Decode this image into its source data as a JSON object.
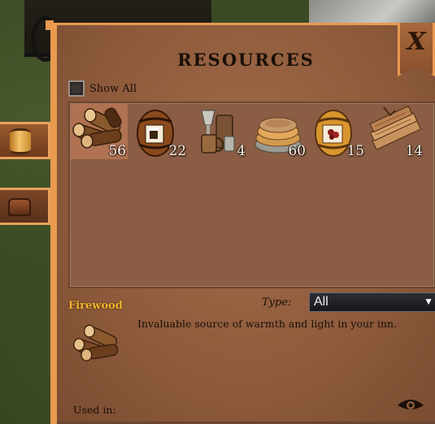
{
  "panel": {
    "title": "RESOURCES",
    "close_label": "X",
    "show_all_label": "Show All",
    "show_all_checked": false
  },
  "resources": [
    {
      "name": "firewood-icon",
      "count": "56",
      "selected": true
    },
    {
      "name": "ale-barrel-icon",
      "count": "22",
      "selected": false
    },
    {
      "name": "tankard-goblet-icon",
      "count": "4",
      "selected": false
    },
    {
      "name": "plates-icon",
      "count": "60",
      "selected": false
    },
    {
      "name": "wine-barrel-icon",
      "count": "15",
      "selected": false
    },
    {
      "name": "planks-icon",
      "count": "14",
      "selected": false
    }
  ],
  "detail": {
    "name": "Firewood",
    "type_label": "Type:",
    "type_value": "All",
    "description": "Invaluable source of warmth and light in your inn.",
    "used_in_label": "Used in:"
  },
  "side_tabs": [
    {
      "name": "barrel-tab-icon",
      "active": true
    },
    {
      "name": "chest-tab-icon",
      "active": false
    }
  ],
  "colors": {
    "accent_border": "#e89a4e",
    "panel_bg": "#8d5a3b",
    "highlight_text": "#f0b42e"
  }
}
